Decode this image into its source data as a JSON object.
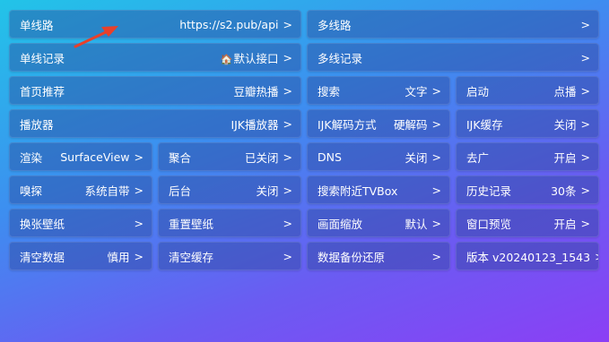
{
  "accent_arrow_color": "#e8402a",
  "rows": [
    [
      {
        "label": "单线路",
        "value": "https://s2.pub/api",
        "chevron": ">",
        "col": 0,
        "span": 2
      },
      {
        "label": "多线路",
        "value": "",
        "chevron": ">",
        "col": 2,
        "span": 2
      }
    ],
    [
      {
        "label": "单线记录",
        "value": "默认接口",
        "icon": "house-icon",
        "chevron": ">",
        "col": 0,
        "span": 2
      },
      {
        "label": "多线记录",
        "value": "",
        "chevron": ">",
        "col": 2,
        "span": 2
      }
    ],
    [
      {
        "label": "首页推荐",
        "value": "豆瓣热播",
        "chevron": ">",
        "col": 0,
        "span": 2
      },
      {
        "label": "搜索",
        "value": "文字",
        "chevron": ">",
        "col": 2,
        "span": 1
      },
      {
        "label": "启动",
        "value": "点播",
        "chevron": ">",
        "col": 3,
        "span": 1
      }
    ],
    [
      {
        "label": "播放器",
        "value": "IJK播放器",
        "chevron": ">",
        "col": 0,
        "span": 2
      },
      {
        "label": "IJK解码方式",
        "value": "硬解码",
        "chevron": ">",
        "col": 2,
        "span": 1
      },
      {
        "label": "IJK缓存",
        "value": "关闭",
        "chevron": ">",
        "col": 3,
        "span": 1
      }
    ],
    [
      {
        "label": "渲染",
        "value": "SurfaceView",
        "chevron": ">",
        "col": 0,
        "span": 1
      },
      {
        "label": "聚合",
        "value": "已关闭",
        "chevron": ">",
        "col": 1,
        "span": 1
      },
      {
        "label": "DNS",
        "value": "关闭",
        "chevron": ">",
        "col": 2,
        "span": 1
      },
      {
        "label": "去广",
        "value": "开启",
        "chevron": ">",
        "col": 3,
        "span": 1
      }
    ],
    [
      {
        "label": "嗅探",
        "value": "系统自带",
        "chevron": ">",
        "col": 0,
        "span": 1
      },
      {
        "label": "后台",
        "value": "关闭",
        "chevron": ">",
        "col": 1,
        "span": 1
      },
      {
        "label": "搜索附近TVBox",
        "value": "",
        "chevron": ">",
        "col": 2,
        "span": 1
      },
      {
        "label": "历史记录",
        "value": "30条",
        "chevron": ">",
        "col": 3,
        "span": 1
      }
    ],
    [
      {
        "label": "换张壁纸",
        "value": "",
        "chevron": ">",
        "col": 0,
        "span": 1
      },
      {
        "label": "重置壁纸",
        "value": "",
        "chevron": ">",
        "col": 1,
        "span": 1
      },
      {
        "label": "画面缩放",
        "value": "默认",
        "chevron": ">",
        "col": 2,
        "span": 1
      },
      {
        "label": "窗口预览",
        "value": "开启",
        "chevron": ">",
        "col": 3,
        "span": 1
      }
    ],
    [
      {
        "label": "清空数据",
        "value": "慎用",
        "chevron": ">",
        "col": 0,
        "span": 1
      },
      {
        "label": "清空缓存",
        "value": "",
        "chevron": ">",
        "col": 1,
        "span": 1
      },
      {
        "label": "数据备份还原",
        "value": "",
        "chevron": ">",
        "col": 2,
        "span": 1
      },
      {
        "label": "版本 v20240123_1543",
        "value": "",
        "chevron": ">",
        "col": 3,
        "span": 1
      }
    ]
  ]
}
